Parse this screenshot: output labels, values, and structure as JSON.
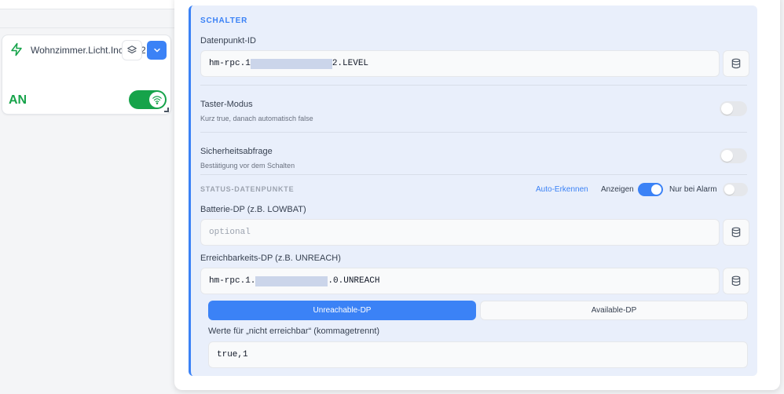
{
  "widget": {
    "title": "Wohnzimmer.Licht.Inc",
    "title_tail": "2",
    "state": "AN",
    "toggle_on": true,
    "icons": [
      "bolt-icon",
      "layers-icon",
      "chevron-down-icon",
      "wifi-icon"
    ]
  },
  "section": {
    "title": "SCHALTER",
    "datapoint_label": "Datenpunkt-ID",
    "datapoint_prefix": "hm-rpc.1",
    "datapoint_suffix": "2.LEVEL",
    "taster_label": "Taster-Modus",
    "taster_hint": "Kurz true, danach automatisch false",
    "taster_on": false,
    "sicher_label": "Sicherheitsabfrage",
    "sicher_hint": "Bestätigung vor dem Schalten",
    "sicher_on": false
  },
  "status": {
    "title": "STATUS-DATENPUNKTE",
    "auto_link": "Auto-Erkennen",
    "anzeigen_label": "Anzeigen",
    "anzeigen_on": true,
    "alarm_label": "Nur bei Alarm",
    "alarm_on": false,
    "battery_label": "Batterie-DP (z.B. LOWBAT)",
    "battery_placeholder": "optional",
    "reach_label": "Erreichbarkeits-DP (z.B. UNREACH)",
    "reach_prefix": "hm-rpc.1.",
    "reach_suffix": ".0.UNREACH",
    "seg_unreach": "Unreachable-DP",
    "seg_avail": "Available-DP",
    "values_label": "Werte für „nicht erreichbar“ (kommagetrennt)",
    "values_value": "true,1"
  },
  "colors": {
    "accent": "#3b82f6",
    "success": "#16a34a",
    "section_bg": "#e9effb"
  }
}
